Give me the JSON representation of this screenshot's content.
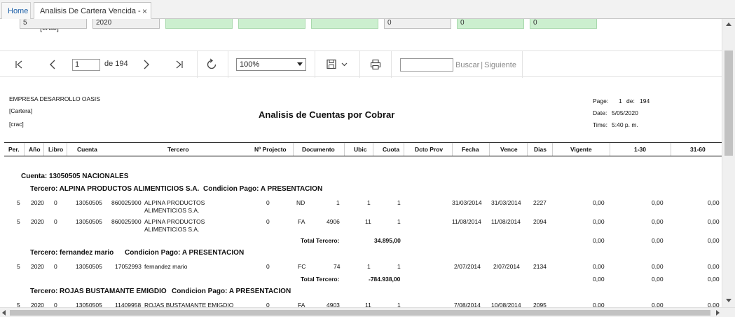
{
  "tabs": {
    "home": "Home",
    "active": "Analisis De Cartera Vencida -[crac]",
    "close": "×"
  },
  "filters": {
    "period": "5",
    "year": "2020",
    "f6": "0",
    "f7": "0",
    "f8": "0"
  },
  "toolbar": {
    "page": "1",
    "of_pages": "de 194",
    "zoom": "100%",
    "find": "Buscar",
    "next": "Siguiente"
  },
  "report": {
    "company": "EMPRESA DESARROLLO OASIS",
    "module": "[Cartera]",
    "code": "[crac]",
    "title": "Analisis de Cuentas por Cobrar",
    "page_label": "Page:",
    "page_num": "1",
    "page_of": "de:",
    "page_total": "194",
    "date_label": "Date:",
    "date": "5/05/2020",
    "time_label": "Time:",
    "time": "5:40 p. m.",
    "columns": [
      "Per.",
      "Año",
      "Libro",
      "Cuenta",
      "Tercero",
      "Nº Projecto",
      "Documento",
      "Ubic",
      "Cuota",
      "Dcto Prov",
      "Fecha",
      "Vence",
      "Dias",
      "Vigente",
      "1-30",
      "31-60"
    ],
    "cuenta_label": "Cuenta: 13050505  NACIONALES",
    "group1": {
      "tercero": "Tercero: ALPINA PRODUCTOS ALIMENTICIOS S.A.",
      "condicion": "Condicion Pago: A PRESENTACION",
      "rows": [
        {
          "per": "5",
          "ano": "2020",
          "libro": "0",
          "cuenta": "13050505",
          "nit": "860025900",
          "tercero1": "ALPINA PRODUCTOS",
          "tercero2": "ALIMENTICIOS S.A.",
          "proy": "0",
          "tipo": "ND",
          "doc": "1",
          "ubic": "1",
          "cuota": "1",
          "fecha": "31/03/2014",
          "vence": "31/03/2014",
          "dias": "2227",
          "vigente": "0,00",
          "r1": "0,00",
          "r2": "0,00"
        },
        {
          "per": "5",
          "ano": "2020",
          "libro": "0",
          "cuenta": "13050505",
          "nit": "860025900",
          "tercero1": "ALPINA PRODUCTOS",
          "tercero2": "ALIMENTICIOS S.A.",
          "proy": "0",
          "tipo": "FA",
          "doc": "4906",
          "ubic": "11",
          "cuota": "1",
          "fecha": "11/08/2014",
          "vence": "11/08/2014",
          "dias": "2094",
          "vigente": "0,00",
          "r1": "0,00",
          "r2": "0,00"
        }
      ],
      "total_label": "Total Tercero:",
      "total": "34.895,00",
      "t_vigente": "0,00",
      "t_r1": "0,00",
      "t_r2": "0,00"
    },
    "group2": {
      "tercero": "Tercero: fernandez  mario",
      "condicion": "Condicion Pago: A PRESENTACION",
      "row": {
        "per": "5",
        "ano": "2020",
        "libro": "0",
        "cuenta": "13050505",
        "nit": "17052993",
        "tercero1": "fernandez  mario",
        "proy": "0",
        "tipo": "FC",
        "doc": "74",
        "ubic": "1",
        "cuota": "1",
        "fecha": "2/07/2014",
        "vence": "2/07/2014",
        "dias": "2134",
        "vigente": "0,00",
        "r1": "0,00",
        "r2": "0,00"
      },
      "total_label": "Total Tercero:",
      "total": "-784.938,00",
      "t_vigente": "0,00",
      "t_r1": "0,00",
      "t_r2": "0,00"
    },
    "group3": {
      "tercero": "Tercero: ROJAS BUSTAMANTE EMIGDIO",
      "condicion": "Condicion Pago: A PRESENTACION",
      "row": {
        "per": "5",
        "ano": "2020",
        "libro": "0",
        "cuenta": "13050505",
        "nit": "11409958",
        "tercero1": "ROJAS BUSTAMANTE EMIGDIO",
        "proy": "0",
        "tipo": "FA",
        "doc": "4903",
        "ubic": "11",
        "cuota": "1",
        "fecha": "7/08/2014",
        "vence": "10/08/2014",
        "dias": "2095",
        "vigente": "0,00",
        "r1": "0,00",
        "r2": "0,00"
      }
    }
  }
}
